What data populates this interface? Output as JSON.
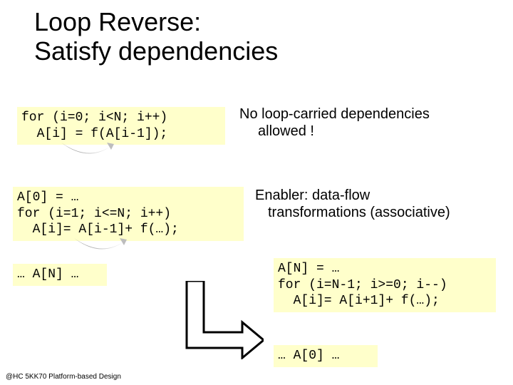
{
  "title_line1": "Loop Reverse:",
  "title_line2": "Satisfy dependencies",
  "code1": "for (i=0; i<N; i++)\n  A[i] = f(A[i-1]);",
  "note1_a": "No loop-carried dependencies",
  "note1_b": "allowed !",
  "code2": "A[0] = …\nfor (i=1; i<=N; i++)\n  A[i]= A[i-1]+ f(…);",
  "note2_a": "Enabler: data-flow",
  "note2_b": "transformations (associative)",
  "code3": "… A[N] …",
  "code4": "A[N] = …\nfor (i=N-1; i>=0; i--)\n  A[i]= A[i+1]+ f(…);",
  "code5": "… A[0] …",
  "footer": "@HC 5KK70 Platform-based Design"
}
